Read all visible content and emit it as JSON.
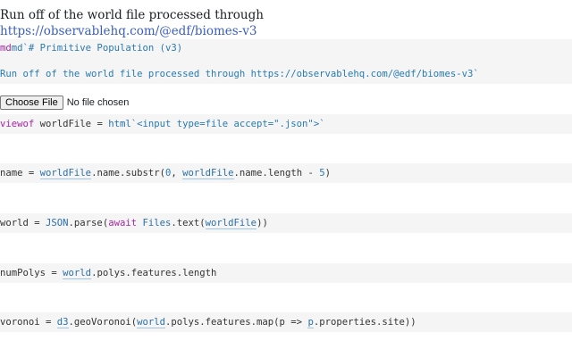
{
  "output": {
    "text_before": "Run off of the world file processed through ",
    "link_text": "https://observablehq.com/@edf/biomes-v3"
  },
  "cells": {
    "md_line1": "md`# Primitive Population (v3)",
    "md_line2": "Run off of the world file processed through https://observablehq.com/@edf/biomes-v3`",
    "viewof": {
      "kw": "viewof",
      "rest": " worldFile = ",
      "html": "html",
      "str": "`<input type=file accept=\".json\">`"
    },
    "name": {
      "lhs": "name = ",
      "ref1": "worldFile",
      "mid1": ".name.substr(",
      "n0": "0",
      "sep": ", ",
      "ref2": "worldFile",
      "mid2": ".name.length - ",
      "n5": "5",
      "end": ")"
    },
    "world": {
      "lhs": "world = ",
      "fn": "JSON",
      "mid": ".parse(",
      "kw": "await",
      "sp": " ",
      "files": "Files",
      "mid2": ".text(",
      "ref": "worldFile",
      "end": "))"
    },
    "numPolys": {
      "lhs": "numPolys = ",
      "ref": "world",
      "rest": ".polys.features.length"
    },
    "voronoi": {
      "lhs": "voronoi = ",
      "ref1": "d3",
      "mid1": ".geoVoronoi(",
      "ref2": "world",
      "mid2": ".polys.features.map(p => ",
      "p": "p",
      "end": ".properties.site))"
    }
  },
  "file_input": {
    "button_label": "Choose File",
    "status": "No file chosen"
  },
  "colors": {
    "keyword": "#a626a4",
    "string": "#2a7ab0",
    "link": "#3b5fc0"
  }
}
